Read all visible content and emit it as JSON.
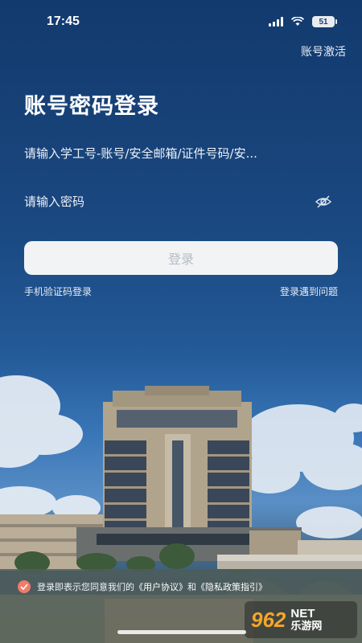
{
  "status_bar": {
    "time": "17:45",
    "battery": "51"
  },
  "header": {
    "activate_link": "账号激活"
  },
  "form": {
    "title": "账号密码登录",
    "account_placeholder": "请输入学工号-账号/安全邮箱/证件号码/安...",
    "password_placeholder": "请输入密码",
    "login_button": "登录",
    "sms_login_link": "手机验证码登录",
    "problem_link": "登录遇到问题"
  },
  "agreement": {
    "prefix": "登录即表示您同意我们的",
    "user_agreement": "《用户协议》",
    "and": "和",
    "privacy_policy": "《隐私政策指引》"
  },
  "watermark": {
    "brand": "962",
    "net": "NET",
    "cn": "乐游网"
  },
  "colors": {
    "accent": "#f07b6a",
    "button_bg": "#f1f3f5",
    "button_text": "#b7bcc4"
  },
  "icons": [
    "wifi-icon",
    "signal-icon",
    "battery-icon",
    "eye-off-icon",
    "check-icon"
  ]
}
